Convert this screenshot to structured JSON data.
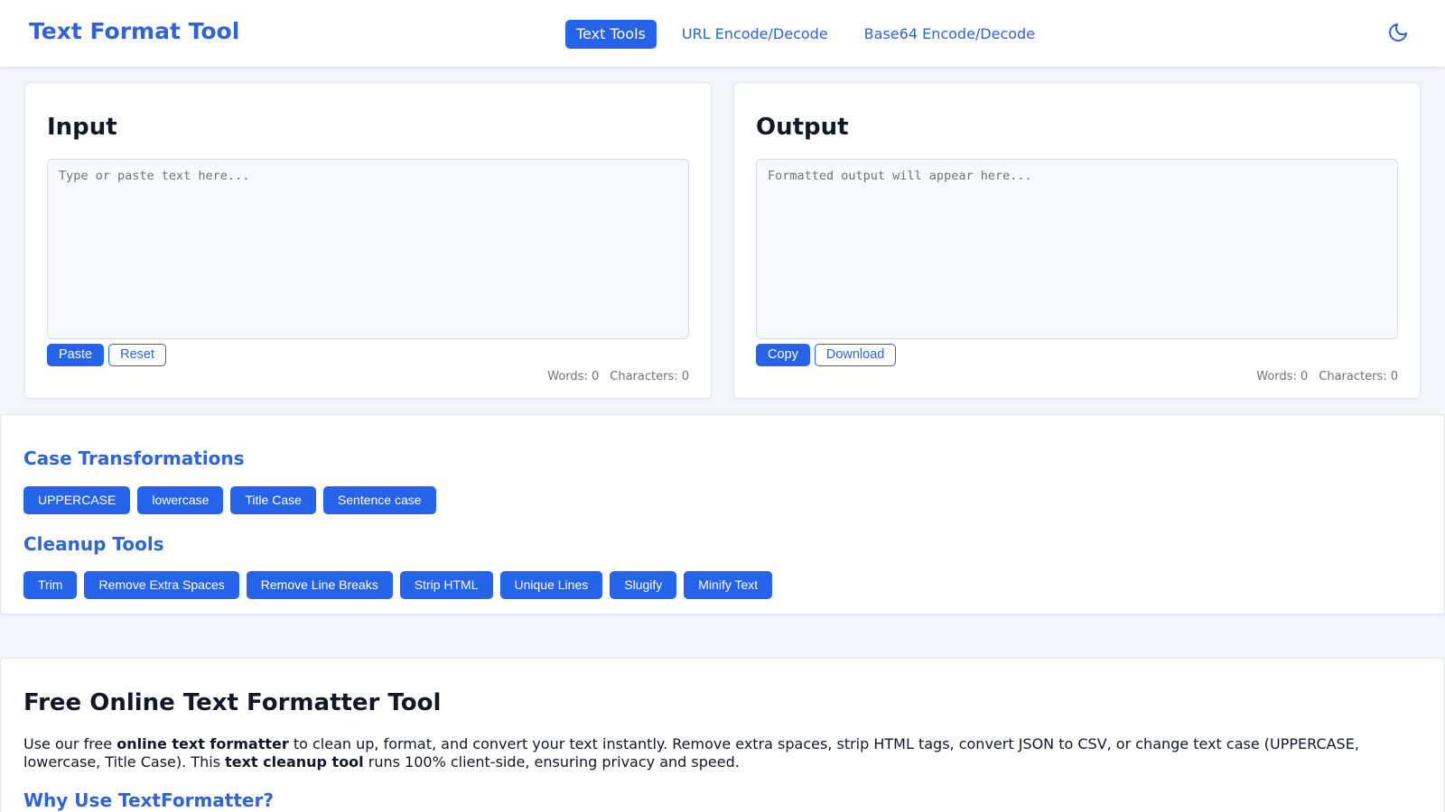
{
  "header": {
    "brand": "Text Format Tool",
    "nav": [
      {
        "label": "Text Tools",
        "active": true
      },
      {
        "label": "URL Encode/Decode",
        "active": false
      },
      {
        "label": "Base64 Encode/Decode",
        "active": false
      }
    ],
    "theme_icon": "moon-icon"
  },
  "input": {
    "title": "Input",
    "placeholder": "Type or paste text here...",
    "value": "",
    "paste_label": "Paste",
    "reset_label": "Reset",
    "words_label": "Words: 0",
    "chars_label": "Characters: 0"
  },
  "output": {
    "title": "Output",
    "placeholder": "Formatted output will appear here...",
    "value": "",
    "copy_label": "Copy",
    "download_label": "Download",
    "words_label": "Words: 0",
    "chars_label": "Characters: 0"
  },
  "tools": {
    "case_title": "Case Transformations",
    "case_buttons": [
      "UPPERCASE",
      "lowercase",
      "Title Case",
      "Sentence case"
    ],
    "cleanup_title": "Cleanup Tools",
    "cleanup_buttons": [
      "Trim",
      "Remove Extra Spaces",
      "Remove Line Breaks",
      "Strip HTML",
      "Unique Lines",
      "Slugify",
      "Minify Text"
    ]
  },
  "about": {
    "title": "Free Online Text Formatter Tool",
    "p1_a": "Use our free ",
    "p1_b": "online text formatter",
    "p1_c": " to clean up, format, and convert your text instantly. Remove extra spaces, strip HTML tags, convert JSON to CSV, or change text case (UPPERCASE, lowercase, Title Case). This ",
    "p1_d": "text cleanup tool",
    "p1_e": " runs 100% client-side, ensuring privacy and speed.",
    "subtitle": "Why Use TextFormatter?"
  },
  "colors": {
    "accent": "#2563eb",
    "brand_text": "#2f64d6",
    "background": "#f3f6fa"
  }
}
